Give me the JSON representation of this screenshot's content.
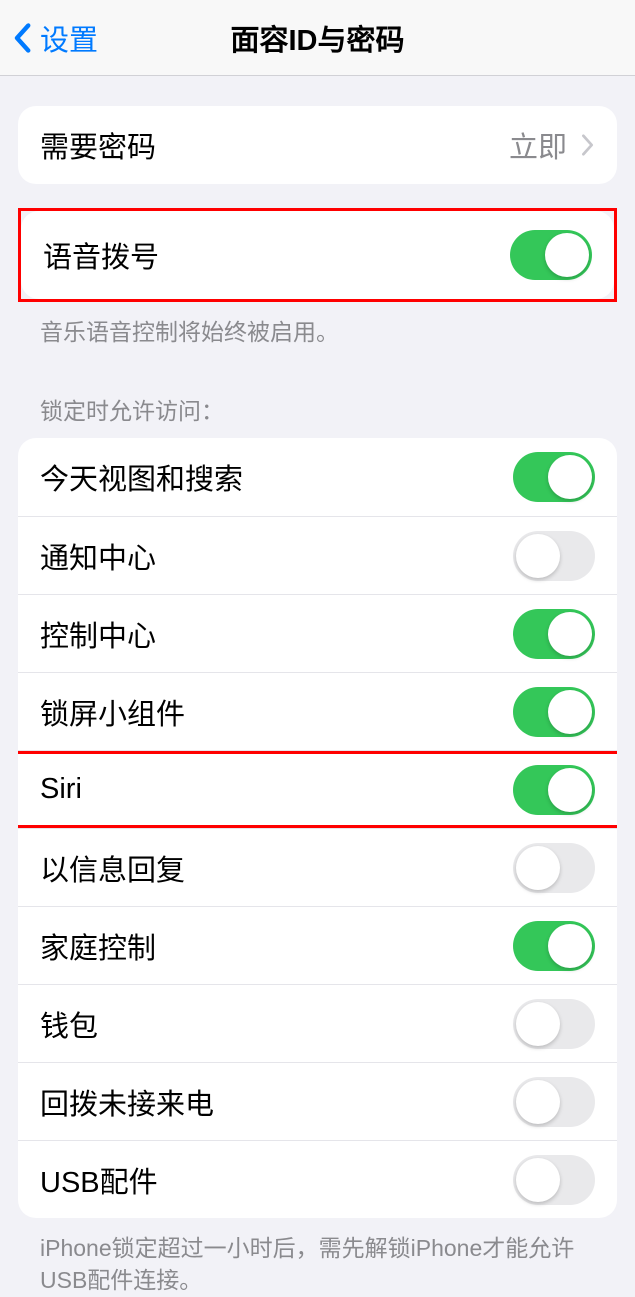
{
  "header": {
    "back_label": "设置",
    "title": "面容ID与密码"
  },
  "require_passcode": {
    "label": "需要密码",
    "value": "立即"
  },
  "voice_dial": {
    "label": "语音拨号",
    "on": true,
    "footer": "音乐语音控制将始终被启用。"
  },
  "locked_access": {
    "header": "锁定时允许访问：",
    "footer": "iPhone锁定超过一小时后，需先解锁iPhone才能允许USB配件连接。",
    "items": [
      {
        "label": "今天视图和搜索",
        "on": true
      },
      {
        "label": "通知中心",
        "on": false
      },
      {
        "label": "控制中心",
        "on": true
      },
      {
        "label": "锁屏小组件",
        "on": true
      },
      {
        "label": "Siri",
        "on": true
      },
      {
        "label": "以信息回复",
        "on": false
      },
      {
        "label": "家庭控制",
        "on": true
      },
      {
        "label": "钱包",
        "on": false
      },
      {
        "label": "回拨未接来电",
        "on": false
      },
      {
        "label": "USB配件",
        "on": false
      }
    ]
  }
}
